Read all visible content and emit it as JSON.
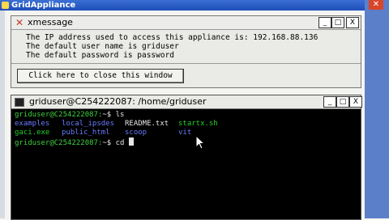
{
  "outer": {
    "title": "GridAppliance",
    "close_icon": "close-icon"
  },
  "xmessage": {
    "title": "xmessage",
    "icon": "x-icon",
    "lines": [
      "The IP address used to access this appliance is: 192.168.88.136",
      "The default user name is griduser",
      "The default password is password"
    ],
    "close_button": "Click here to close this window",
    "controls": {
      "minimize": "_",
      "maximize": "□",
      "close": "X"
    }
  },
  "terminal": {
    "title": "griduser@C254222087: /home/griduser",
    "controls": {
      "minimize": "_",
      "maximize": "□",
      "close": "X"
    },
    "prompt": "griduser@C254222087:",
    "prompt_suffix": "~$ ",
    "command1": "ls",
    "listing": [
      [
        {
          "text": "examples",
          "color": "blue"
        },
        {
          "text": "local_ipsdes",
          "color": "blue"
        },
        {
          "text": "README.txt",
          "color": "white"
        },
        {
          "text": "startx.sh",
          "color": "green"
        }
      ],
      [
        {
          "text": "gaci.exe",
          "color": "green"
        },
        {
          "text": "public_html",
          "color": "blue"
        },
        {
          "text": "scoop",
          "color": "blue"
        },
        {
          "text": "vit",
          "color": "blue"
        }
      ]
    ],
    "command2": "cd "
  }
}
